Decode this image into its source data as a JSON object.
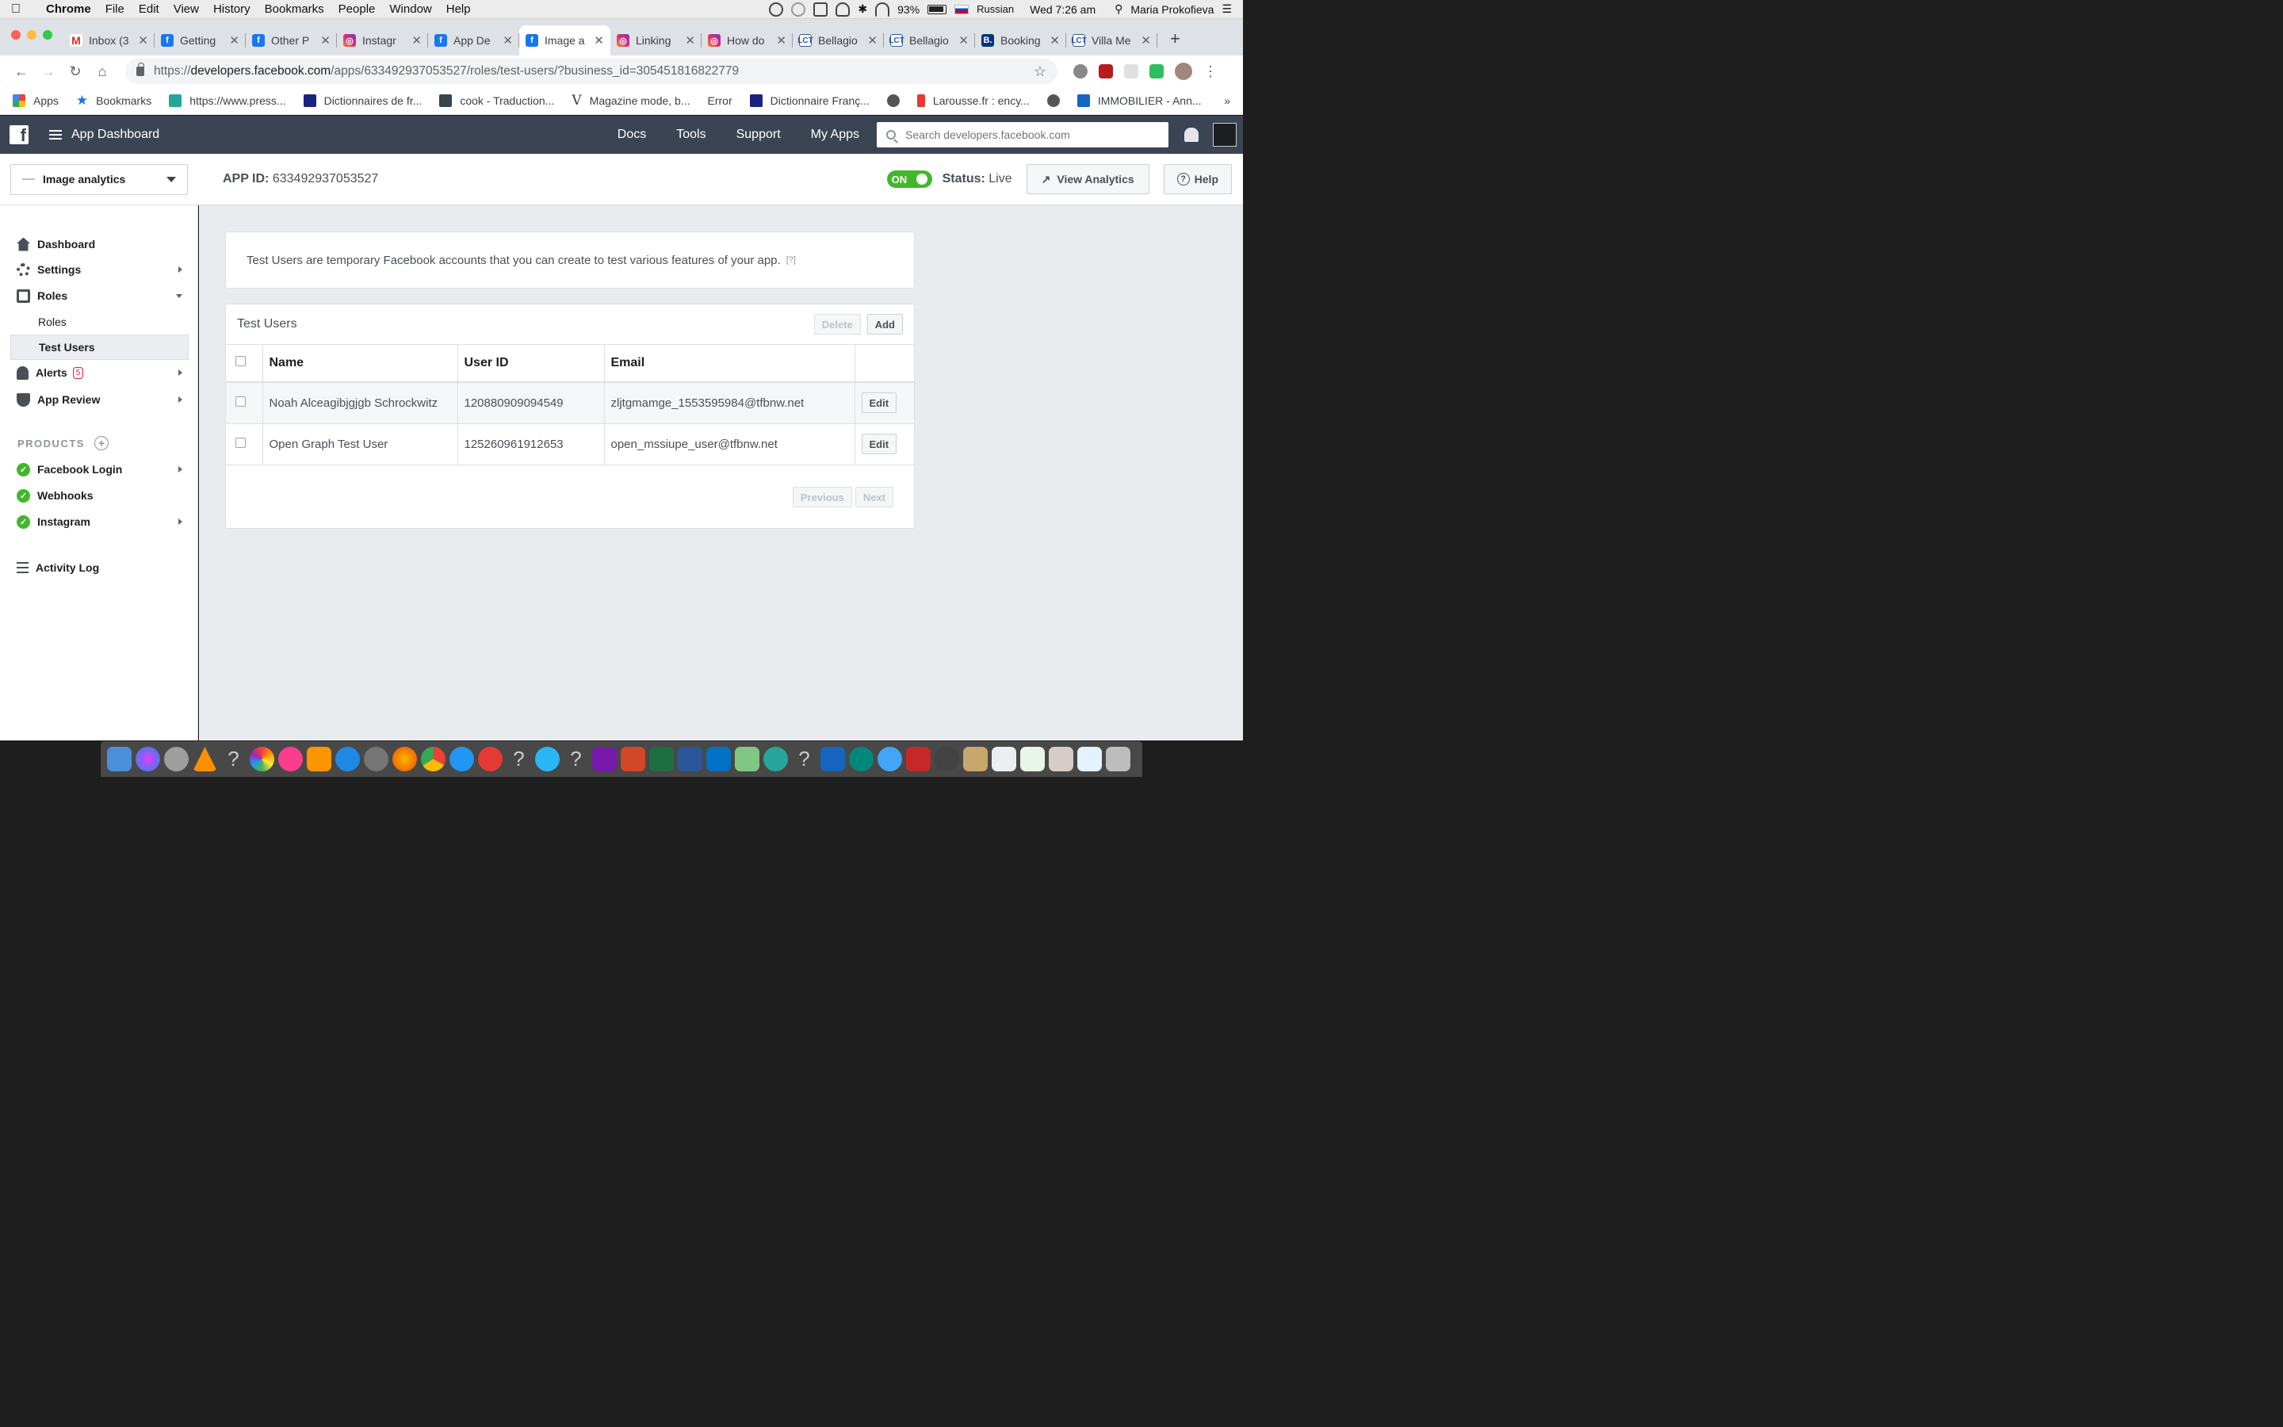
{
  "mac": {
    "app_name": "Chrome",
    "menus": [
      "File",
      "Edit",
      "View",
      "History",
      "Bookmarks",
      "People",
      "Window",
      "Help"
    ],
    "battery": "93%",
    "input_source": "Russian",
    "clock": "Wed 7:26 am",
    "user": "Maria Prokofieva"
  },
  "tabs": [
    {
      "title": "Inbox (3",
      "icon": "gmail-icon"
    },
    {
      "title": "Getting",
      "icon": "facebook-icon"
    },
    {
      "title": "Other P",
      "icon": "facebook-icon"
    },
    {
      "title": "Instagr",
      "icon": "instagram-icon"
    },
    {
      "title": "App De",
      "icon": "facebook-icon"
    },
    {
      "title": "Image a",
      "icon": "facebook-icon"
    },
    {
      "title": "Linking",
      "icon": "instagram-icon"
    },
    {
      "title": "How do",
      "icon": "instagram-icon"
    },
    {
      "title": "Bellagio",
      "icon": "lct-icon"
    },
    {
      "title": "Bellagio",
      "icon": "lct-icon"
    },
    {
      "title": "Booking",
      "icon": "booking-icon"
    },
    {
      "title": "Villa Me",
      "icon": "lct-icon"
    }
  ],
  "address": {
    "scheme": "https://",
    "host": "developers.facebook.com",
    "path": "/apps/633492937053527/roles/test-users/?business_id=305451816822779"
  },
  "bookmarks": [
    "Apps",
    "Bookmarks",
    "https://www.press...",
    "Dictionnaires de fr...",
    "cook - Traduction...",
    "Magazine mode, b...",
    "Error",
    "Dictionnaire Franç...",
    "Larousse.fr : ency...",
    "IMMOBILIER - Ann..."
  ],
  "fb": {
    "dash_title": "App Dashboard",
    "nav": [
      "Docs",
      "Tools",
      "Support",
      "My Apps"
    ],
    "search_placeholder": "Search developers.facebook.com"
  },
  "app": {
    "name": "Image analytics",
    "id_label": "APP ID:",
    "id_value": "633492937053527",
    "toggle_label": "ON",
    "status_label": "Status:",
    "status_value": "Live",
    "analytics_btn": "View Analytics",
    "help_btn": "Help"
  },
  "sidebar": {
    "dashboard": "Dashboard",
    "settings": "Settings",
    "roles": "Roles",
    "roles_sub": "Roles",
    "test_users": "Test Users",
    "alerts": "Alerts",
    "alerts_count": "5",
    "app_review": "App Review",
    "products_header": "PRODUCTS",
    "facebook_login": "Facebook Login",
    "webhooks": "Webhooks",
    "instagram": "Instagram",
    "activity_log": "Activity Log"
  },
  "main": {
    "info_text": "Test Users are temporary Facebook accounts that you can create to test various features of your app.",
    "info_hint": "[?]",
    "card_title": "Test Users",
    "delete_btn": "Delete",
    "add_btn": "Add",
    "columns": [
      "Name",
      "User ID",
      "Email"
    ],
    "rows": [
      {
        "name": "Noah Alceagibjgjgb Schrockwitz",
        "user_id": "120880909094549",
        "email": "zljtgmamge_1553595984@tfbnw.net",
        "action": "Edit"
      },
      {
        "name": "Open Graph Test User",
        "user_id": "125260961912653",
        "email": "open_mssiupe_user@tfbnw.net",
        "action": "Edit"
      }
    ],
    "prev_btn": "Previous",
    "next_btn": "Next"
  },
  "colors": {
    "fb_header": "#3b4453",
    "toggle_on": "#42b72a",
    "alert_red": "#e41e3f"
  }
}
